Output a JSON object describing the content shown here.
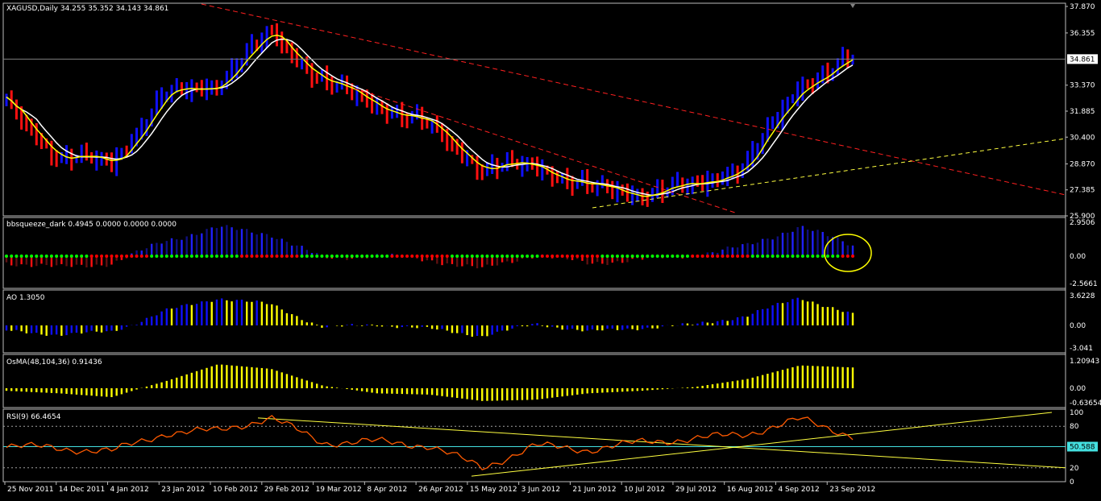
{
  "colors": {
    "bull": "#1010ff",
    "bear": "#ff1010",
    "ma_yellow": "#ffff00",
    "ma_white": "#ffffff",
    "trend_red": "#ff2020",
    "trend_yellow": "#ffff40",
    "squeeze_on": "#00ff00",
    "squeeze_off": "#ff0000",
    "ao_up": "#1010ff",
    "ao_down": "#ffff00",
    "osma": "#ffff00",
    "rsi": "#ff5a00",
    "price_line": "#7f7f7f",
    "rsi_line": "#44e0e0"
  },
  "panels": {
    "main": {
      "label": "XAGUSD,Daily  34.255 35.352 34.143 34.861",
      "ticks": [
        "37.870",
        "36.355",
        "34.861",
        "33.370",
        "31.885",
        "30.400",
        "28.870",
        "27.385",
        "25.900"
      ],
      "current_value": "34.861"
    },
    "bbsqueeze": {
      "label": "bbsqueeze_dark 0.4945 0.0000 0.0000 0.0000",
      "ticks": [
        "2.9506",
        "0.00",
        "-2.5661"
      ]
    },
    "ao": {
      "label": "AO 1.3050",
      "ticks": [
        "3.6228",
        "0.00",
        "-3.041"
      ]
    },
    "osma": {
      "label": "OsMA(48,104,36) 0.91436",
      "ticks": [
        "1.20943",
        "0.00",
        "-0.63654"
      ]
    },
    "rsi": {
      "label": "RSI(9) 66.4654",
      "ticks": [
        "100",
        "80",
        "20",
        "0"
      ],
      "current_value": "50.588"
    }
  },
  "x_labels": [
    "25 Nov 2011",
    "14 Dec 2011",
    "4 Jan 2012",
    "23 Jan 2012",
    "10 Feb 2012",
    "29 Feb 2012",
    "19 Mar 2012",
    "8 Apr 2012",
    "26 Apr 2012",
    "15 May 2012",
    "3 Jun 2012",
    "21 Jun 2012",
    "10 Jul 2012",
    "29 Jul 2012",
    "16 Aug 2012",
    "4 Sep 2012",
    "23 Sep 2012"
  ],
  "chart_data": {
    "type": "bar",
    "symbol": "XAGUSD",
    "timeframe": "Daily",
    "last_bar": {
      "open": 34.255,
      "high": 35.352,
      "low": 34.143,
      "close": 34.861
    },
    "ylim": [
      25.9,
      37.87
    ],
    "x": [
      "2011-11-25",
      "2011-12-14",
      "2012-01-04",
      "2012-01-23",
      "2012-02-10",
      "2012-02-29",
      "2012-03-19",
      "2012-04-08",
      "2012-04-26",
      "2012-05-15",
      "2012-06-03",
      "2012-06-21",
      "2012-07-10",
      "2012-07-29",
      "2012-08-16",
      "2012-09-04",
      "2012-09-23"
    ],
    "close_series": [
      32.3,
      29.2,
      29.0,
      32.8,
      33.5,
      36.4,
      33.5,
      32.3,
      31.0,
      28.6,
      28.8,
      27.5,
      27.2,
      27.6,
      28.9,
      33.4,
      34.86
    ],
    "rsi_series": [
      52,
      48,
      44,
      70,
      74,
      92,
      56,
      58,
      52,
      20,
      52,
      46,
      57,
      62,
      69,
      90,
      66.47
    ],
    "ao_series": [
      -0.8,
      -1.4,
      -0.9,
      1.8,
      3.4,
      2.6,
      -0.3,
      0.1,
      -0.5,
      -1.6,
      0.2,
      -0.9,
      -0.4,
      0.1,
      1.2,
      3.5,
      1.3
    ],
    "osma_series": [
      -0.1,
      -0.2,
      -0.35,
      0.3,
      1.05,
      0.85,
      0.1,
      -0.2,
      -0.25,
      -0.5,
      -0.45,
      -0.2,
      -0.1,
      0.05,
      0.4,
      1.0,
      0.91
    ]
  }
}
